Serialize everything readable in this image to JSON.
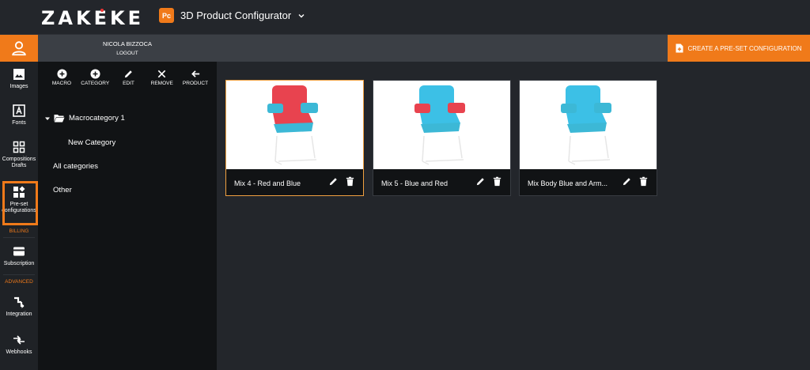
{
  "brand": {
    "logo_text": "ZAKEKE",
    "accent": "#f07a1a",
    "background": "#23262b",
    "panel": "#111315"
  },
  "project": {
    "badge": "Pc",
    "name": "3D Product Configurator"
  },
  "user": {
    "name": "NICOLA BIZZOCA",
    "logout": "LOGOUT"
  },
  "rail": {
    "items": [
      {
        "label": "Images",
        "icon": "image-icon"
      },
      {
        "label": "Fonts",
        "icon": "font-icon"
      },
      {
        "label": "Compositions Drafts",
        "icon": "grid-icon"
      },
      {
        "label": "Pre-set configurations",
        "icon": "widgets-icon"
      }
    ],
    "billing_label": "BILLING",
    "subscription_label": "Subscription",
    "advanced_label": "ADVANCED",
    "integration_label": "Integration",
    "webhooks_label": "Webhooks"
  },
  "toolbar": {
    "macro": "MACRO",
    "category": "CATEGORY",
    "edit": "EDIT",
    "remove": "REMOVE",
    "product": "PRODUCT"
  },
  "tree": {
    "macrocategory": "Macrocategory 1",
    "new_category": "New Category",
    "all_categories": "All categories",
    "other": "Other"
  },
  "cta": {
    "label": "CREATE A PRE-SET CONFIGURATION"
  },
  "cards": [
    {
      "title": "Mix 4 - Red and Blue",
      "selected": true,
      "seat": "#e8434f",
      "back": "#e8434f",
      "arms": "#3cb8d6"
    },
    {
      "title": "Mix 5 - Blue and Red",
      "selected": false,
      "seat": "#3cc0e6",
      "back": "#3cc0e6",
      "arms": "#e8434f"
    },
    {
      "title": "Mix Body Blue and Arm...",
      "selected": false,
      "seat": "#3cc0e6",
      "back": "#3cc0e6",
      "arms": "#3cb8d6"
    }
  ]
}
